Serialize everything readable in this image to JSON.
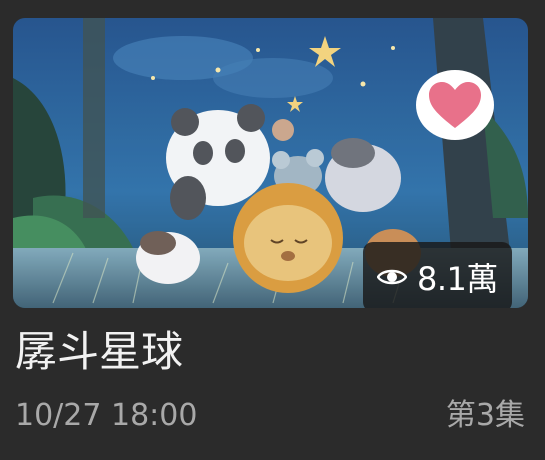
{
  "card": {
    "title": "孱斗星球",
    "datetime": "10/27 18:00",
    "episode": "第3集",
    "views": "8.1萬",
    "favorite_icon": "heart-icon",
    "views_icon": "eye-icon",
    "thumbnail_alt": "cartoon animals sleeping under a starry sky"
  },
  "colors": {
    "background": "#2b2b2b",
    "heart": "#e8718a",
    "title_text": "#f2f2f2",
    "meta_text": "#a9a9a9"
  }
}
